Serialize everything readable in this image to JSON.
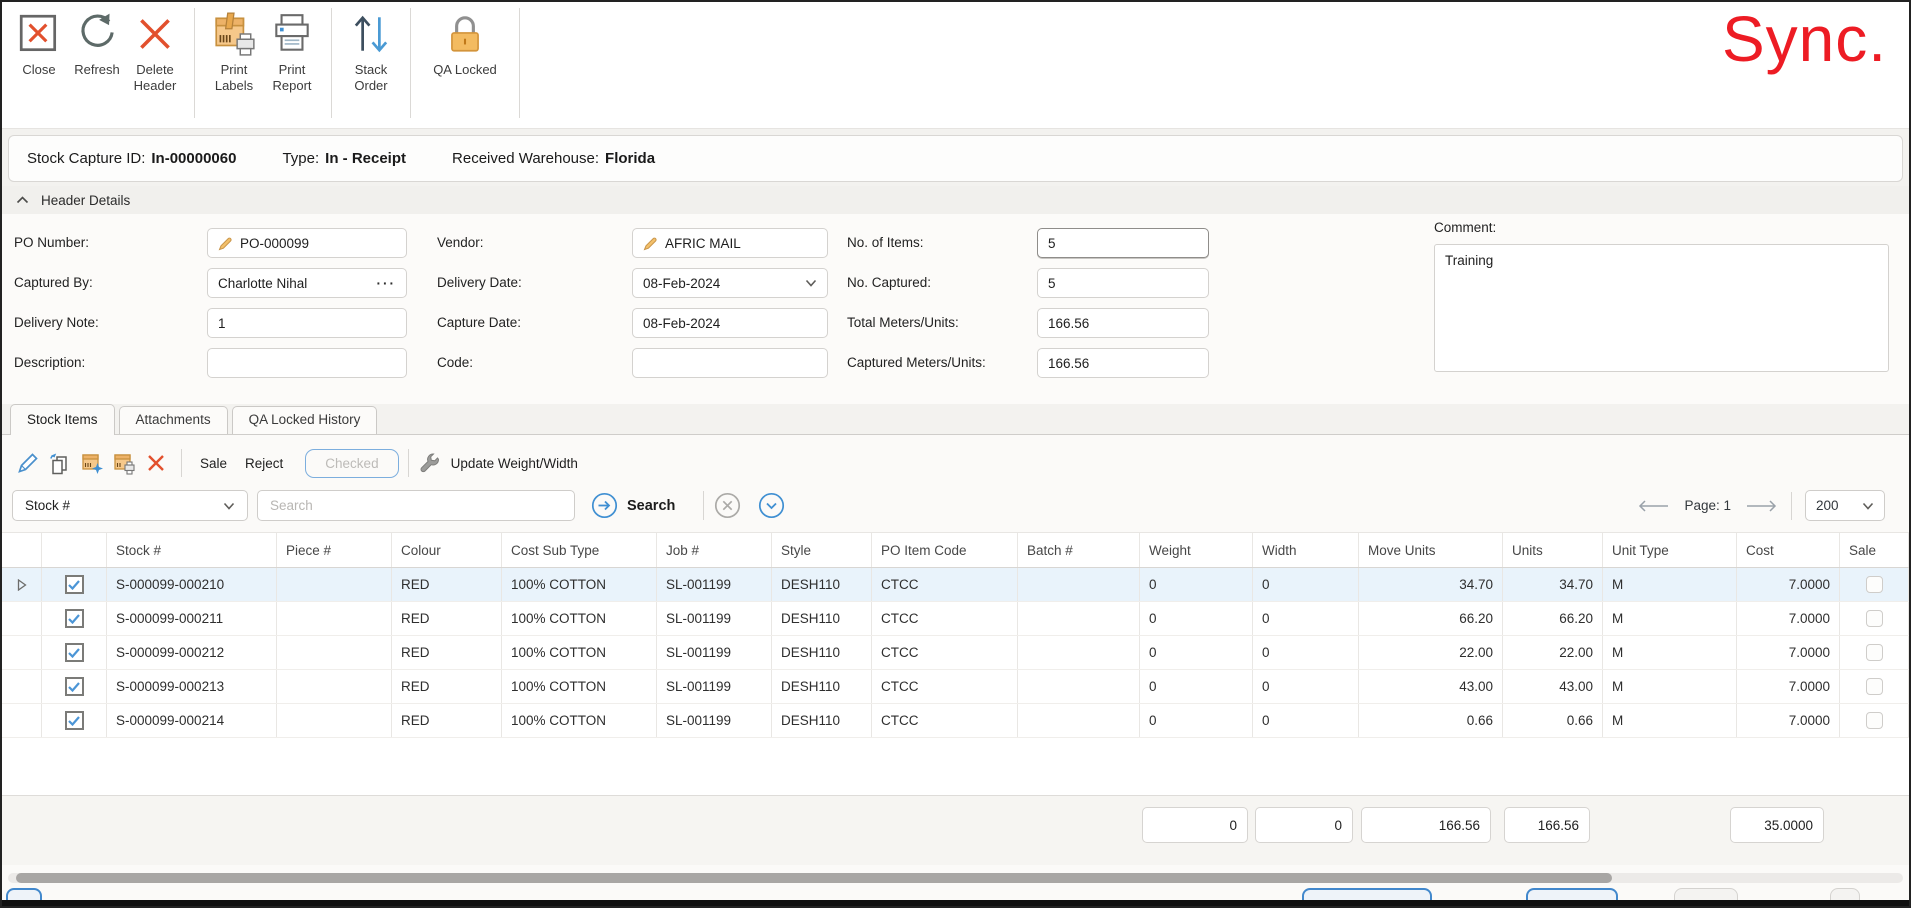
{
  "brand": {
    "logo_text": "Sync.",
    "logo_color": "#ED1C24"
  },
  "ribbon": {
    "buttons": [
      {
        "name": "close",
        "label": "Close"
      },
      {
        "name": "refresh",
        "label": "Refresh"
      },
      {
        "name": "delete-header",
        "label": "Delete\nHeader"
      },
      {
        "name": "print-labels",
        "label": "Print\nLabels"
      },
      {
        "name": "print-report",
        "label": "Print\nReport"
      },
      {
        "name": "stack-order",
        "label": "Stack\nOrder"
      },
      {
        "name": "qa-locked",
        "label": "QA Locked"
      }
    ]
  },
  "info_bar": [
    {
      "label": "Stock Capture ID:",
      "value": "In-00000060"
    },
    {
      "label": "Type:",
      "value": "In - Receipt"
    },
    {
      "label": "Received Warehouse:",
      "value": "Florida"
    }
  ],
  "header_details": {
    "section_title": "Header Details",
    "columns": [
      {
        "fields": [
          {
            "label": "PO Number:",
            "value": "PO-000099",
            "icon": "pencil"
          },
          {
            "label": "Captured By:",
            "value": "Charlotte Nihal",
            "suffix": "ellipsis"
          },
          {
            "label": "Delivery Note:",
            "value": "1"
          },
          {
            "label": "Description:",
            "value": ""
          }
        ]
      },
      {
        "fields": [
          {
            "label": "Vendor:",
            "value": "AFRIC MAIL",
            "icon": "pencil"
          },
          {
            "label": "Delivery Date:",
            "value": "08-Feb-2024",
            "suffix": "chevron"
          },
          {
            "label": "Capture Date:",
            "value": "08-Feb-2024"
          },
          {
            "label": "Code:",
            "value": ""
          }
        ]
      },
      {
        "fields": [
          {
            "label": "No. of Items:",
            "value": "5",
            "focused": true
          },
          {
            "label": "No. Captured:",
            "value": "5"
          },
          {
            "label": "Total Meters/Units:",
            "value": "166.56"
          },
          {
            "label": "Captured Meters/Units:",
            "value": "166.56"
          }
        ]
      }
    ],
    "comment": {
      "label": "Comment:",
      "value": "Training"
    }
  },
  "tabs": [
    {
      "label": "Stock Items",
      "active": true
    },
    {
      "label": "Attachments",
      "active": false
    },
    {
      "label": "QA Locked History",
      "active": false
    }
  ],
  "items_toolbar": {
    "sale_label": "Sale",
    "reject_label": "Reject",
    "checked_label": "Checked",
    "update_label": "Update Weight/Width"
  },
  "search": {
    "filter_field": "Stock #",
    "placeholder": "Search",
    "button_label": "Search"
  },
  "pagination": {
    "label": "Page: 1",
    "page_size": "200"
  },
  "table": {
    "columns": [
      {
        "key": "expander",
        "label": "",
        "align": "center"
      },
      {
        "key": "checkbox",
        "label": "",
        "align": "center"
      },
      {
        "key": "stock",
        "label": "Stock #",
        "align": "left"
      },
      {
        "key": "piece",
        "label": "Piece #",
        "align": "left"
      },
      {
        "key": "colour",
        "label": "Colour",
        "align": "left"
      },
      {
        "key": "cost_sub_type",
        "label": "Cost Sub Type",
        "align": "left"
      },
      {
        "key": "job",
        "label": "Job #",
        "align": "left"
      },
      {
        "key": "style",
        "label": "Style",
        "align": "left"
      },
      {
        "key": "po_item_code",
        "label": "PO Item Code",
        "align": "left"
      },
      {
        "key": "batch",
        "label": "Batch #",
        "align": "left"
      },
      {
        "key": "weight",
        "label": "Weight",
        "align": "left"
      },
      {
        "key": "width",
        "label": "Width",
        "align": "left"
      },
      {
        "key": "move_units",
        "label": "Move Units",
        "align": "right"
      },
      {
        "key": "units",
        "label": "Units",
        "align": "right"
      },
      {
        "key": "unit_type",
        "label": "Unit Type",
        "align": "left"
      },
      {
        "key": "cost",
        "label": "Cost",
        "align": "right"
      },
      {
        "key": "sale",
        "label": "Sale",
        "align": "center"
      }
    ],
    "rows": [
      {
        "selected": true,
        "checked": true,
        "stock": "S-000099-000210",
        "piece": "",
        "colour": "RED",
        "cost_sub_type": "100% COTTON",
        "job": "SL-001199",
        "style": "DESH110",
        "po_item_code": "CTCC",
        "batch": "",
        "weight": "0",
        "width": "0",
        "move_units": "34.70",
        "units": "34.70",
        "unit_type": "M",
        "cost": "7.0000",
        "sale": false
      },
      {
        "selected": false,
        "checked": true,
        "stock": "S-000099-000211",
        "piece": "",
        "colour": "RED",
        "cost_sub_type": "100% COTTON",
        "job": "SL-001199",
        "style": "DESH110",
        "po_item_code": "CTCC",
        "batch": "",
        "weight": "0",
        "width": "0",
        "move_units": "66.20",
        "units": "66.20",
        "unit_type": "M",
        "cost": "7.0000",
        "sale": false
      },
      {
        "selected": false,
        "checked": true,
        "stock": "S-000099-000212",
        "piece": "",
        "colour": "RED",
        "cost_sub_type": "100% COTTON",
        "job": "SL-001199",
        "style": "DESH110",
        "po_item_code": "CTCC",
        "batch": "",
        "weight": "0",
        "width": "0",
        "move_units": "22.00",
        "units": "22.00",
        "unit_type": "M",
        "cost": "7.0000",
        "sale": false
      },
      {
        "selected": false,
        "checked": true,
        "stock": "S-000099-000213",
        "piece": "",
        "colour": "RED",
        "cost_sub_type": "100% COTTON",
        "job": "SL-001199",
        "style": "DESH110",
        "po_item_code": "CTCC",
        "batch": "",
        "weight": "0",
        "width": "0",
        "move_units": "43.00",
        "units": "43.00",
        "unit_type": "M",
        "cost": "7.0000",
        "sale": false
      },
      {
        "selected": false,
        "checked": true,
        "stock": "S-000099-000214",
        "piece": "",
        "colour": "RED",
        "cost_sub_type": "100% COTTON",
        "job": "SL-001199",
        "style": "DESH110",
        "po_item_code": "CTCC",
        "batch": "",
        "weight": "0",
        "width": "0",
        "move_units": "0.66",
        "units": "0.66",
        "unit_type": "M",
        "cost": "7.0000",
        "sale": false
      }
    ],
    "totals": {
      "weight": "0",
      "width": "0",
      "move_units": "166.56",
      "units": "166.56",
      "cost": "35.0000"
    }
  },
  "colors": {
    "accent_blue": "#3F8FD2",
    "alert_red": "#E2502D",
    "brand_red": "#ED1C24",
    "selected_row": "#E9F3FB",
    "lock_orange": "#F3BB61"
  }
}
